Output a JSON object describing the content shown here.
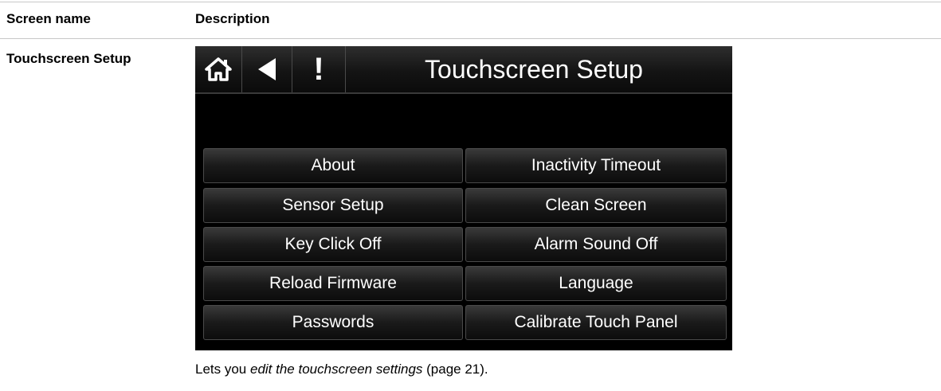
{
  "table": {
    "header_col1": "Screen name",
    "header_col2": "Description",
    "row_name": "Touchscreen Setup"
  },
  "screen": {
    "title": "Touchscreen Setup",
    "nav": {
      "home_icon": "home-icon",
      "back_icon": "back-arrow-icon",
      "alarm_icon": "alarm-icon",
      "alarm_glyph": "!"
    },
    "buttons_left": [
      "About",
      "Sensor Setup",
      "Key Click Off",
      "Reload Firmware",
      "Passwords"
    ],
    "buttons_right": [
      "Inactivity Timeout",
      "Clean Screen",
      "Alarm Sound Off",
      "Language",
      "Calibrate Touch Panel"
    ]
  },
  "description": {
    "prefix": "Lets you ",
    "link_text": "edit the touchscreen settings",
    "suffix": " (page 21)."
  }
}
